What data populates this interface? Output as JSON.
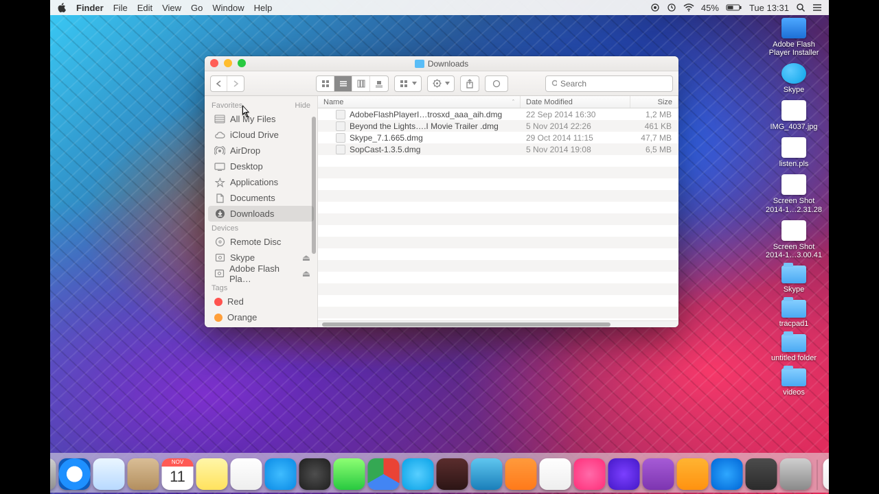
{
  "menubar": {
    "app": "Finder",
    "items": [
      "File",
      "Edit",
      "View",
      "Go",
      "Window",
      "Help"
    ],
    "status": {
      "battery": "45%",
      "clock": "Tue 13:31"
    }
  },
  "desktop_icons": [
    {
      "label": "Adobe Flash\nPlayer Installer",
      "kind": "app"
    },
    {
      "label": "Skype",
      "kind": "skype"
    },
    {
      "label": "IMG_4037.jpg",
      "kind": "file"
    },
    {
      "label": "listen.pls",
      "kind": "file"
    },
    {
      "label": "Screen Shot\n2014-1…2.31.28",
      "kind": "file"
    },
    {
      "label": "Screen Shot\n2014-1…3.00.41",
      "kind": "file"
    },
    {
      "label": "Skype",
      "kind": "folder"
    },
    {
      "label": "tracpad1",
      "kind": "folder"
    },
    {
      "label": "untitled folder",
      "kind": "folder"
    },
    {
      "label": "videos",
      "kind": "folder"
    }
  ],
  "finder": {
    "title": "Downloads",
    "search_placeholder": "Search",
    "sidebar": {
      "favorites_header": "Favorites",
      "hide_label": "Hide",
      "favorites": [
        {
          "label": "All My Files",
          "icon": "all-my-files"
        },
        {
          "label": "iCloud Drive",
          "icon": "icloud"
        },
        {
          "label": "AirDrop",
          "icon": "airdrop"
        },
        {
          "label": "Desktop",
          "icon": "desktop"
        },
        {
          "label": "Applications",
          "icon": "applications"
        },
        {
          "label": "Documents",
          "icon": "documents"
        },
        {
          "label": "Downloads",
          "icon": "downloads",
          "selected": true
        }
      ],
      "devices_header": "Devices",
      "devices": [
        {
          "label": "Remote Disc",
          "icon": "disc"
        },
        {
          "label": "Skype",
          "icon": "dmg",
          "eject": true
        },
        {
          "label": "Adobe Flash Pla…",
          "icon": "dmg",
          "eject": true
        }
      ],
      "tags_header": "Tags",
      "tags": [
        {
          "label": "Red",
          "color": "#ff534f"
        },
        {
          "label": "Orange",
          "color": "#ff9f3a"
        }
      ]
    },
    "columns": {
      "name": "Name",
      "date": "Date Modified",
      "size": "Size"
    },
    "rows": [
      {
        "name": "AdobeFlashPlayerI…trosxd_aaa_aih.dmg",
        "date": "22 Sep 2014 16:30",
        "size": "1,2 MB"
      },
      {
        "name": "Beyond the Lights….I Movie Trailer .dmg",
        "date": "5 Nov 2014 22:26",
        "size": "461 KB"
      },
      {
        "name": "Skype_7.1.665.dmg",
        "date": "29 Oct 2014 11:15",
        "size": "47,7 MB"
      },
      {
        "name": "SopCast-1.3.5.dmg",
        "date": "5 Nov 2014 19:08",
        "size": "6,5 MB"
      }
    ]
  },
  "dock": {
    "apps": [
      {
        "name": "finder",
        "bg": "linear-gradient(#6fd0ff,#1a82e8)"
      },
      {
        "name": "launchpad",
        "bg": "linear-gradient(#cfcfcf,#8f8f8f)"
      },
      {
        "name": "safari",
        "bg": "radial-gradient(circle at 50% 50%,#fff 0 35%,#1e90ff 36% 70%,#0e5bbc 71%)"
      },
      {
        "name": "mail",
        "bg": "linear-gradient(#eaf6ff,#b8d9ff)"
      },
      {
        "name": "contacts",
        "bg": "linear-gradient(#d9be96,#b38f5f)"
      },
      {
        "name": "calendar",
        "bg": "linear-gradient(#fff 55%,#fff),linear-gradient(#ff5a55,#ff5a55)",
        "text": "11"
      },
      {
        "name": "notes",
        "bg": "linear-gradient(#fff6a8,#ffe25e)"
      },
      {
        "name": "reminders",
        "bg": "linear-gradient(#fff,#eee)"
      },
      {
        "name": "messages-blue",
        "bg": "radial-gradient(circle,#3fbcff,#0a8ae5)"
      },
      {
        "name": "quicktime",
        "bg": "radial-gradient(circle at 50% 50%,#4e4e4e,#1e1e1e)"
      },
      {
        "name": "messages",
        "bg": "linear-gradient(#8dff73,#28c940)"
      },
      {
        "name": "chrome",
        "bg": "conic-gradient(#ea4335 0 120deg,#4285f4 120deg 240deg,#34a853 240deg 360deg)"
      },
      {
        "name": "skype-dock",
        "bg": "radial-gradient(circle,#58cfff,#08a1e6)"
      },
      {
        "name": "photos",
        "bg": "linear-gradient(#5b2d2d,#2c1515)"
      },
      {
        "name": "preview",
        "bg": "linear-gradient(#5fc6ef,#1a7fba)"
      },
      {
        "name": "pages",
        "bg": "linear-gradient(#ff9a3c,#ff7a1a)"
      },
      {
        "name": "vlc",
        "bg": "linear-gradient(#fff,#eee)"
      },
      {
        "name": "itunes",
        "bg": "radial-gradient(circle,#ff6aa9,#ff2e79)"
      },
      {
        "name": "imovie",
        "bg": "radial-gradient(circle,#7b3fff,#4418c7)"
      },
      {
        "name": "onenote",
        "bg": "linear-gradient(#a65bd6,#7d35b1)"
      },
      {
        "name": "ibooks",
        "bg": "linear-gradient(#ffb432,#ff9210)"
      },
      {
        "name": "app-store",
        "bg": "radial-gradient(circle,#2ea7ff,#0066d6)"
      },
      {
        "name": "other",
        "bg": "linear-gradient(#4c4c4c,#2b2b2b)"
      },
      {
        "name": "system-preferences",
        "bg": "linear-gradient(#cfcfcf,#8a8a8a)"
      }
    ],
    "tray": [
      {
        "name": "document",
        "bg": "linear-gradient(#fff,#eee)"
      },
      {
        "name": "trash",
        "bg": "linear-gradient(#e7e7e7,#bfbfbf)"
      }
    ],
    "running": [
      "finder"
    ]
  }
}
